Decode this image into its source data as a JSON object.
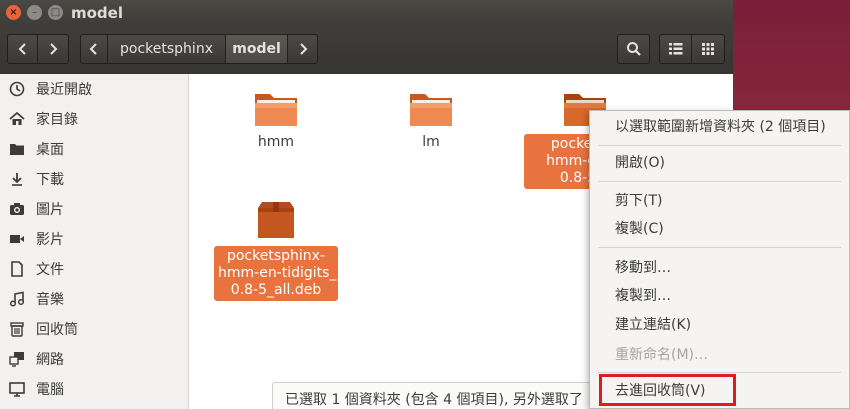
{
  "window": {
    "title": "model"
  },
  "toolbar": {
    "breadcrumbs": [
      "pocketsphinx",
      "model"
    ]
  },
  "sidebar": {
    "items": [
      {
        "label": "最近開啟",
        "icon": "clock-icon"
      },
      {
        "label": "家目錄",
        "icon": "home-icon"
      },
      {
        "label": "桌面",
        "icon": "desktop-folder-icon"
      },
      {
        "label": "下載",
        "icon": "download-icon"
      },
      {
        "label": "圖片",
        "icon": "camera-icon"
      },
      {
        "label": "影片",
        "icon": "video-icon"
      },
      {
        "label": "文件",
        "icon": "document-icon"
      },
      {
        "label": "音樂",
        "icon": "music-icon"
      },
      {
        "label": "回收筒",
        "icon": "trash-icon"
      },
      {
        "label": "網路",
        "icon": "network-icon"
      },
      {
        "label": "電腦",
        "icon": "computer-icon"
      }
    ]
  },
  "files": [
    {
      "name": "hmm",
      "type": "folder",
      "selected": false
    },
    {
      "name": "lm",
      "type": "folder",
      "selected": false
    },
    {
      "name": "pockets…\nhmm-en-…\n0.8-5…",
      "type": "folder",
      "selected": true
    },
    {
      "name": "pocketsphinx-\nhmm-en-tidigits_\n0.8-5_all.deb",
      "type": "package",
      "selected": true
    }
  ],
  "status": {
    "text": "已選取 1 個資料夾 (包含 4 個項目), 另外選取了"
  },
  "context_menu": {
    "new_folder_with_selection": "以選取範圍新增資料夾 (2 個項目)",
    "open": "開啟(O)",
    "cut": "剪下(T)",
    "copy": "複製(C)",
    "move_to": "移動到…",
    "copy_to": "複製到…",
    "make_link": "建立連結(K)",
    "rename": "重新命名(M)…",
    "move_to_trash": "去進回收筒(V)"
  },
  "colors": {
    "accent": "#e9733f",
    "highlight_box": "#d81e1e",
    "toolbar": "#3c3b37"
  }
}
